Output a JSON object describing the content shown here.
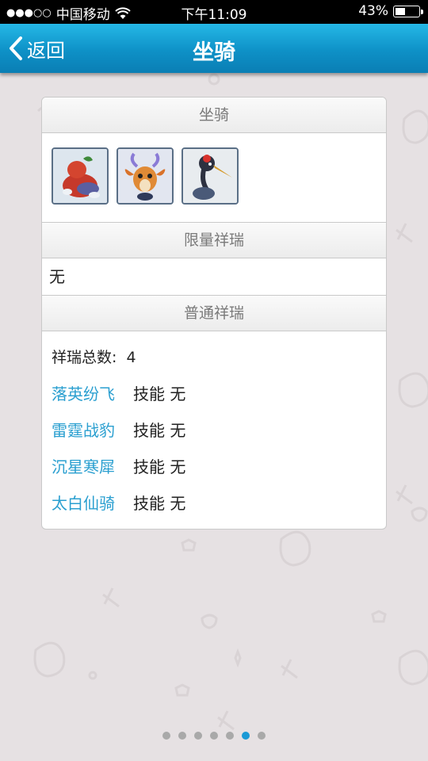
{
  "status_bar": {
    "signal_dots": "●●●○○",
    "carrier": "中国移动",
    "time": "下午11:09",
    "battery_percent": "43%",
    "battery_level": 0.43
  },
  "nav": {
    "back_label": "返回",
    "title": "坐骑"
  },
  "card": {
    "mount_section_title": "坐骑",
    "mount_icons": [
      "gourd-mount-icon",
      "deer-mount-icon",
      "crane-mount-icon"
    ],
    "limited_section_title": "限量祥瑞",
    "limited_value": "无",
    "normal_section_title": "普通祥瑞",
    "total_label": "祥瑞总数:",
    "total_value": "4",
    "rui_list": [
      {
        "name": "落英纷飞",
        "skill": "技能 无"
      },
      {
        "name": "雷霆战豹",
        "skill": "技能 无"
      },
      {
        "name": "沉星寒犀",
        "skill": "技能 无"
      },
      {
        "name": "太白仙骑",
        "skill": "技能 无"
      }
    ]
  },
  "pager": {
    "total": 7,
    "active_index": 5
  },
  "colors": {
    "nav_blue": "#0e91c7",
    "link_blue": "#2a9fd0",
    "active_dot": "#1b9ad6"
  }
}
